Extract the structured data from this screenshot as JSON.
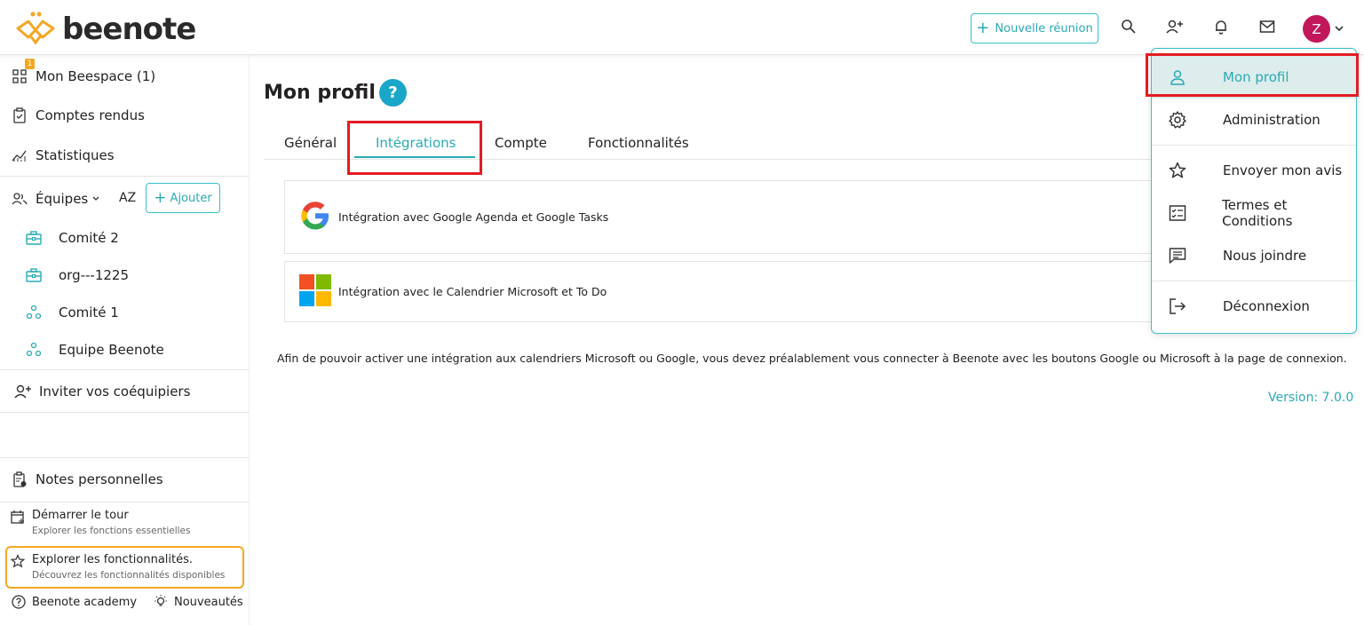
{
  "header": {
    "logo_text": "beenote",
    "new_meeting_label": "Nouvelle réunion",
    "avatar_initial": "Z"
  },
  "sidebar": {
    "beespace_label": "Mon Beespace (1)",
    "beespace_badge": "1",
    "reports_label": "Comptes rendus",
    "stats_label": "Statistiques",
    "teams_label": "Équipes",
    "sort_label": "AZ",
    "add_label": "Ajouter",
    "teams": [
      {
        "name": "Comité 2"
      },
      {
        "name": "org---1225"
      },
      {
        "name": "Comité 1"
      },
      {
        "name": "Equipe Beenote"
      }
    ],
    "invite_label": "Inviter vos coéquipiers",
    "notes_label": "Notes personnelles",
    "tour_title": "Démarrer le tour",
    "tour_sub": "Explorer les fonctions essentielles",
    "explore_title": "Explorer les fonctionnalités.",
    "explore_sub": "Découvrez les fonctionnalités disponibles",
    "academy_label": "Beenote academy",
    "news_label": "Nouveautés"
  },
  "main": {
    "title": "Mon profil",
    "help_symbol": "?",
    "tabs": [
      {
        "label": "Général"
      },
      {
        "label": "Intégrations"
      },
      {
        "label": "Compte"
      },
      {
        "label": "Fonctionnalités"
      }
    ],
    "google_integration": "Intégration avec Google Agenda et Google Tasks",
    "microsoft_integration": "Intégration avec le Calendrier Microsoft et To Do",
    "note": "Afin de pouvoir activer une intégration aux calendriers Microsoft ou Google, vous devez préalablement vous connecter à Beenote avec les boutons Google ou Microsoft à la page de connexion.",
    "version": "Version: 7.0.0"
  },
  "menu": {
    "items": [
      {
        "label": "Mon profil"
      },
      {
        "label": "Administration"
      },
      {
        "label": "Envoyer mon avis"
      },
      {
        "label": "Termes et Conditions"
      },
      {
        "label": "Nous joindre"
      },
      {
        "label": "Déconnexion"
      }
    ]
  },
  "colors": {
    "accent": "#2aaab4",
    "highlight_red": "#e31b23",
    "orange": "#f5a623",
    "avatar": "#c2185b",
    "help": "#1aa6c9"
  }
}
